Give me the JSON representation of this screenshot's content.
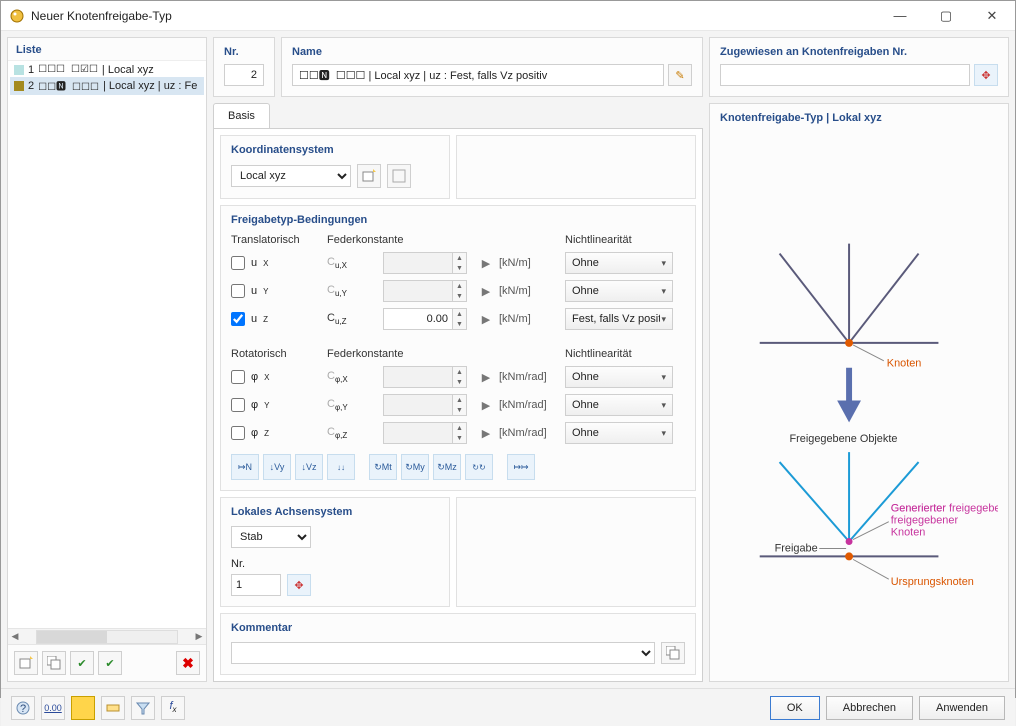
{
  "window": {
    "title": "Neuer Knotenfreigabe-Typ"
  },
  "list": {
    "header": "Liste",
    "items": [
      {
        "swatch": "#b8e2e2",
        "num": "1",
        "flags": "☐☐☐  ☐☑☐",
        "label": "Local xyz"
      },
      {
        "swatch": "#a38a1f",
        "num": "2",
        "flags": "☐☐🅽  ☐☐☐",
        "label": "Local xyz | uᴢ : Fe"
      }
    ],
    "selected": 1
  },
  "nr": {
    "label": "Nr.",
    "value": "2"
  },
  "name": {
    "label": "Name",
    "value": "☐☐🅽  ☐☐☐ | Local xyz | uᴢ : Fest, falls Vᴢ positiv",
    "editicon": "✎"
  },
  "assigned": {
    "label": "Zugewiesen an Knotenfreigaben Nr.",
    "value": "",
    "pickicon": "✥"
  },
  "tabs": {
    "basis": "Basis"
  },
  "coord": {
    "header": "Koordinatensystem",
    "value": "Local xyz"
  },
  "cond": {
    "header": "Freigabetyp-Bedingungen",
    "trans": "Translatorisch",
    "rot": "Rotatorisch",
    "spring": "Federkonstante",
    "nonlin": "Nichtlinearität",
    "rows_trans": [
      {
        "sym": "u",
        "sub": "X",
        "c": "C",
        "csub": "u,X",
        "unit": "[kN/m]",
        "val": "",
        "checked": false,
        "nl": "Ohne",
        "enabled": false
      },
      {
        "sym": "u",
        "sub": "Y",
        "c": "C",
        "csub": "u,Y",
        "unit": "[kN/m]",
        "val": "",
        "checked": false,
        "nl": "Ohne",
        "enabled": false
      },
      {
        "sym": "u",
        "sub": "Z",
        "c": "C",
        "csub": "u,Z",
        "unit": "[kN/m]",
        "val": "0.00",
        "checked": true,
        "nl": "Fest, falls Vᴢ positiv",
        "enabled": true
      }
    ],
    "rows_rot": [
      {
        "sym": "φ",
        "sub": "X",
        "c": "C",
        "csub": "φ,X",
        "unit": "[kNm/rad]",
        "val": "",
        "checked": false,
        "nl": "Ohne",
        "enabled": false
      },
      {
        "sym": "φ",
        "sub": "Y",
        "c": "C",
        "csub": "φ,Y",
        "unit": "[kNm/rad]",
        "val": "",
        "checked": false,
        "nl": "Ohne",
        "enabled": false
      },
      {
        "sym": "φ",
        "sub": "Z",
        "c": "C",
        "csub": "φ,Z",
        "unit": "[kNm/rad]",
        "val": "",
        "checked": false,
        "nl": "Ohne",
        "enabled": false
      }
    ]
  },
  "localaxis": {
    "header": "Lokales Achsensystem",
    "value": "Stab",
    "nrlabel": "Nr.",
    "nrvalue": "1"
  },
  "comment": {
    "header": "Kommentar",
    "value": ""
  },
  "preview": {
    "header": "Knotenfreigabe-Typ | Lokal xyz",
    "lbl_knoten": "Knoten",
    "lbl_released": "Freigegebene Objekte",
    "lbl_freigabe": "Freigabe",
    "lbl_gen": "Generierter freigegebener Knoten",
    "lbl_origin": "Ursprungsknoten"
  },
  "footer": {
    "ok": "OK",
    "cancel": "Abbrechen",
    "apply": "Anwenden"
  }
}
